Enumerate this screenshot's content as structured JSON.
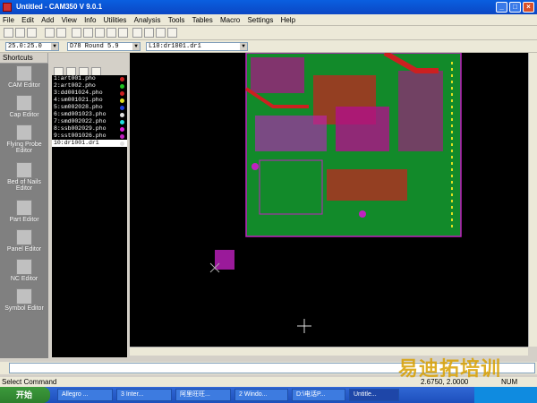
{
  "window": {
    "title": "Untitled - CAM350 V 9.0.1"
  },
  "menu": [
    "File",
    "Edit",
    "Add",
    "View",
    "Info",
    "Utilities",
    "Analysis",
    "Tools",
    "Tables",
    "Macro",
    "Settings",
    "Help"
  ],
  "combos": {
    "grid": "25.0:25.0",
    "dcode": "D78   Round 5.9",
    "layer": "L10:dr1001.dr1"
  },
  "shortcuts": {
    "header": "Shortcuts",
    "items": [
      "CAM Editor",
      "Cap Editor",
      "Flying Probe Editor",
      "Bed of Nails Editor",
      "Part Editor",
      "Panel Editor",
      "NC Editor",
      "Symbol Editor"
    ]
  },
  "layers": [
    {
      "label": "1:art001.pho",
      "color": "#cc2020"
    },
    {
      "label": "2:art002.pho",
      "color": "#20c020"
    },
    {
      "label": "3:dd001024.pho",
      "color": "#cc2020"
    },
    {
      "label": "4:sm001021.pho",
      "color": "#e0e020"
    },
    {
      "label": "5:sm002028.pho",
      "color": "#2040e0"
    },
    {
      "label": "6:smd001023.pho",
      "color": "#e0e0e0"
    },
    {
      "label": "7:smd002022.pho",
      "color": "#20e0e0"
    },
    {
      "label": "8:ssb002029.pho",
      "color": "#e020e0"
    },
    {
      "label": "9:sst001026.pho",
      "color": "#c020c0"
    },
    {
      "label": "10:dr1001.dr1",
      "color": "#e0e0e0"
    }
  ],
  "status": {
    "left": "Select Command",
    "coords": "2.6750, 2.0000",
    "num": "NUM"
  },
  "taskbar": {
    "start": "开始",
    "tasks": [
      "Allegro ...",
      "3 Inter...",
      "阿里旺旺...",
      "2 Windo...",
      "D:\\电话P...",
      "Untitle..."
    ]
  },
  "watermark": "易迪拓培训"
}
